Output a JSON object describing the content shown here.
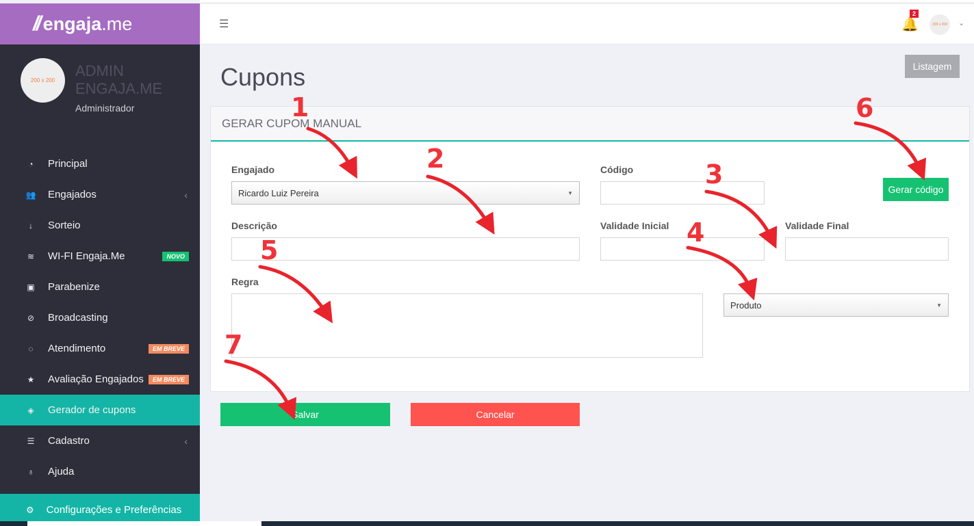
{
  "brand": {
    "logo_mark": "//",
    "name_bold": "engaja",
    "name_thin": ".me"
  },
  "profile": {
    "avatar_text": "200 x 200",
    "name": "ADMIN ENGAJA.ME",
    "role": "Administrador"
  },
  "nav": {
    "items": [
      {
        "label": "Principal",
        "icon": "dashboard-icon"
      },
      {
        "label": "Engajados",
        "icon": "users-icon",
        "chevron": "‹"
      },
      {
        "label": "Sorteio",
        "icon": "sort-icon"
      },
      {
        "label": "WI-FI Engaja.Me",
        "icon": "wifi-icon",
        "badge": "NOVO"
      },
      {
        "label": "Parabenize",
        "icon": "gift-icon"
      },
      {
        "label": "Broadcasting",
        "icon": "compass-icon"
      },
      {
        "label": "Atendimento",
        "icon": "chat-icon",
        "badge": "EM BREVE"
      },
      {
        "label": "Avaliação Engajados",
        "icon": "star-icon",
        "badge": "EM BREVE"
      },
      {
        "label": "Gerador de cupons",
        "icon": "tag-icon"
      },
      {
        "label": "Cadastro",
        "icon": "sliders-icon",
        "chevron": "‹"
      },
      {
        "label": "Ajuda",
        "icon": "bulb-icon"
      }
    ],
    "settings": "Configurações e Preferências"
  },
  "topbar": {
    "notifications": "2",
    "user_avatar_text": "200 x 200"
  },
  "page": {
    "title": "Cupons",
    "list_button": "Listagem",
    "panel_title": "GERAR CUPOM MANUAL"
  },
  "form": {
    "engajado_label": "Engajado",
    "engajado_value": "Ricardo Luiz Pereira",
    "codigo_label": "Código",
    "codigo_value": "",
    "gerar_button": "Gerar código",
    "descricao_label": "Descrição",
    "descricao_value": "",
    "validade_inicial_label": "Validade Inicial",
    "validade_inicial_value": "",
    "validade_final_label": "Validade Final",
    "validade_final_value": "",
    "regra_label": "Regra",
    "regra_value": "",
    "tipo_value": "Produto",
    "save_button": "Salvar",
    "cancel_button": "Cancelar"
  },
  "annotations": [
    "1",
    "2",
    "3",
    "4",
    "5",
    "6",
    "7"
  ],
  "colors": {
    "brand": "#a56cc1",
    "sidebar": "#2d2e3a",
    "accent": "#14b5a6",
    "success": "#16c272",
    "danger": "#ff5350",
    "annotation": "#f0333a"
  }
}
